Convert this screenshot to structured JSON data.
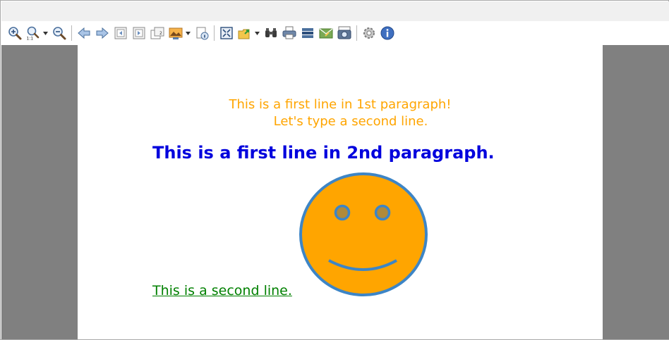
{
  "toolbar": {
    "buttons": [
      {
        "name": "zoom-in-icon"
      },
      {
        "name": "zoom-actual-icon",
        "has_dropdown": true
      },
      {
        "name": "zoom-out-icon"
      },
      {
        "name": "back-arrow-icon"
      },
      {
        "name": "forward-arrow-icon"
      },
      {
        "name": "first-page-icon"
      },
      {
        "name": "last-page-icon"
      },
      {
        "name": "page-number-icon"
      },
      {
        "name": "background-image-icon",
        "has_dropdown": true
      },
      {
        "name": "page-setup-icon"
      },
      {
        "name": "fit-page-icon"
      },
      {
        "name": "export-icon",
        "has_dropdown": true
      },
      {
        "name": "find-binoculars-icon"
      },
      {
        "name": "print-icon"
      },
      {
        "name": "quick-print-icon"
      },
      {
        "name": "send-email-icon"
      },
      {
        "name": "snapshot-icon"
      },
      {
        "name": "settings-gear-icon"
      },
      {
        "name": "about-info-icon"
      }
    ]
  },
  "document": {
    "paragraph1": {
      "line1": "This is a first line in 1st paragraph!",
      "line2": "Let's type a second line.",
      "color": "#ffa500"
    },
    "paragraph2": {
      "text": "This is a first line in 2nd paragraph.",
      "color": "#0000dd"
    },
    "paragraph3": {
      "text": "This is a second line.",
      "color": "#008000"
    },
    "smiley": {
      "face_color": "#ffa500",
      "outline_color": "#3d85c6"
    }
  },
  "colors": {
    "viewer_background": "#808080",
    "page_background": "#ffffff",
    "topbar_background": "#f0f0f0"
  }
}
